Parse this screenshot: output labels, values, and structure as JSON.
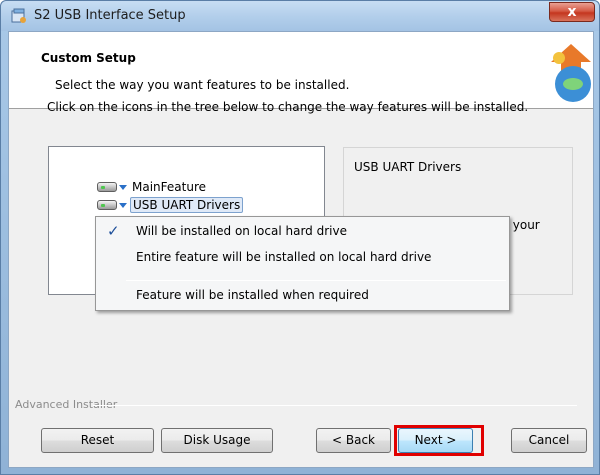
{
  "window": {
    "title": "S2 USB Interface Setup",
    "close_glyph": "x"
  },
  "header": {
    "title": "Custom Setup",
    "subtitle": "Select the way you want features to be installed."
  },
  "instruction": "Click on the icons in the tree below to change the way features will be installed.",
  "tree": {
    "items": [
      {
        "label": "MainFeature",
        "icon": "hard-drive-icon",
        "selected": false
      },
      {
        "label": "USB UART Drivers",
        "icon": "hard-drive-icon",
        "selected": true
      }
    ]
  },
  "description": {
    "title": "USB UART Drivers",
    "partial_text": "on your"
  },
  "context_menu": {
    "items": [
      {
        "label": "Will be installed on local hard drive",
        "checked": true
      },
      {
        "label": "Entire feature will be installed on local hard drive",
        "checked": false
      },
      {
        "label": "Feature will be installed when required",
        "checked": false
      }
    ]
  },
  "footer": {
    "brand": "Advanced Installer",
    "buttons": {
      "reset": "Reset",
      "disk_usage": "Disk Usage",
      "back": "< Back",
      "next": "Next >",
      "cancel": "Cancel"
    }
  },
  "colors": {
    "highlight": "#e00000",
    "accent": "#2a70c8"
  }
}
